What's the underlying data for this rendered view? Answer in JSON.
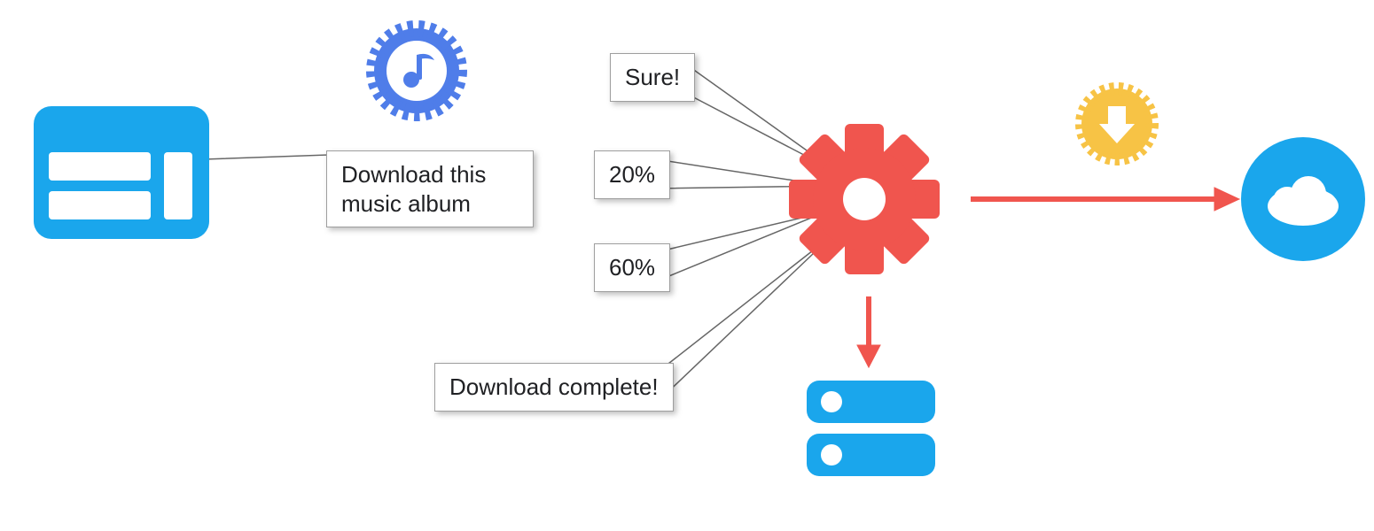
{
  "diagram": {
    "colors": {
      "blue": "#1aa6ec",
      "dark_blue": "#4f7de9",
      "red": "#f0554e",
      "yellow": "#f7c345",
      "shadow": "rgba(0,0,0,0.25)"
    },
    "nodes": {
      "app_window": {
        "role": "client app / UI"
      },
      "music_badge": {
        "role": "music certificate badge"
      },
      "gear": {
        "role": "downloader / background service"
      },
      "download_badge": {
        "role": "download certificate badge"
      },
      "cloud": {
        "role": "remote server / cloud"
      },
      "storage": {
        "role": "local storage / disks"
      }
    },
    "messages": {
      "request": "Download this\nmusic album",
      "ack": "Sure!",
      "progress1": "20%",
      "progress2": "60%",
      "complete": "Download complete!"
    },
    "arrows": [
      {
        "from": "gear",
        "to": "cloud",
        "direction": "right"
      },
      {
        "from": "gear",
        "to": "storage",
        "direction": "down"
      }
    ]
  }
}
